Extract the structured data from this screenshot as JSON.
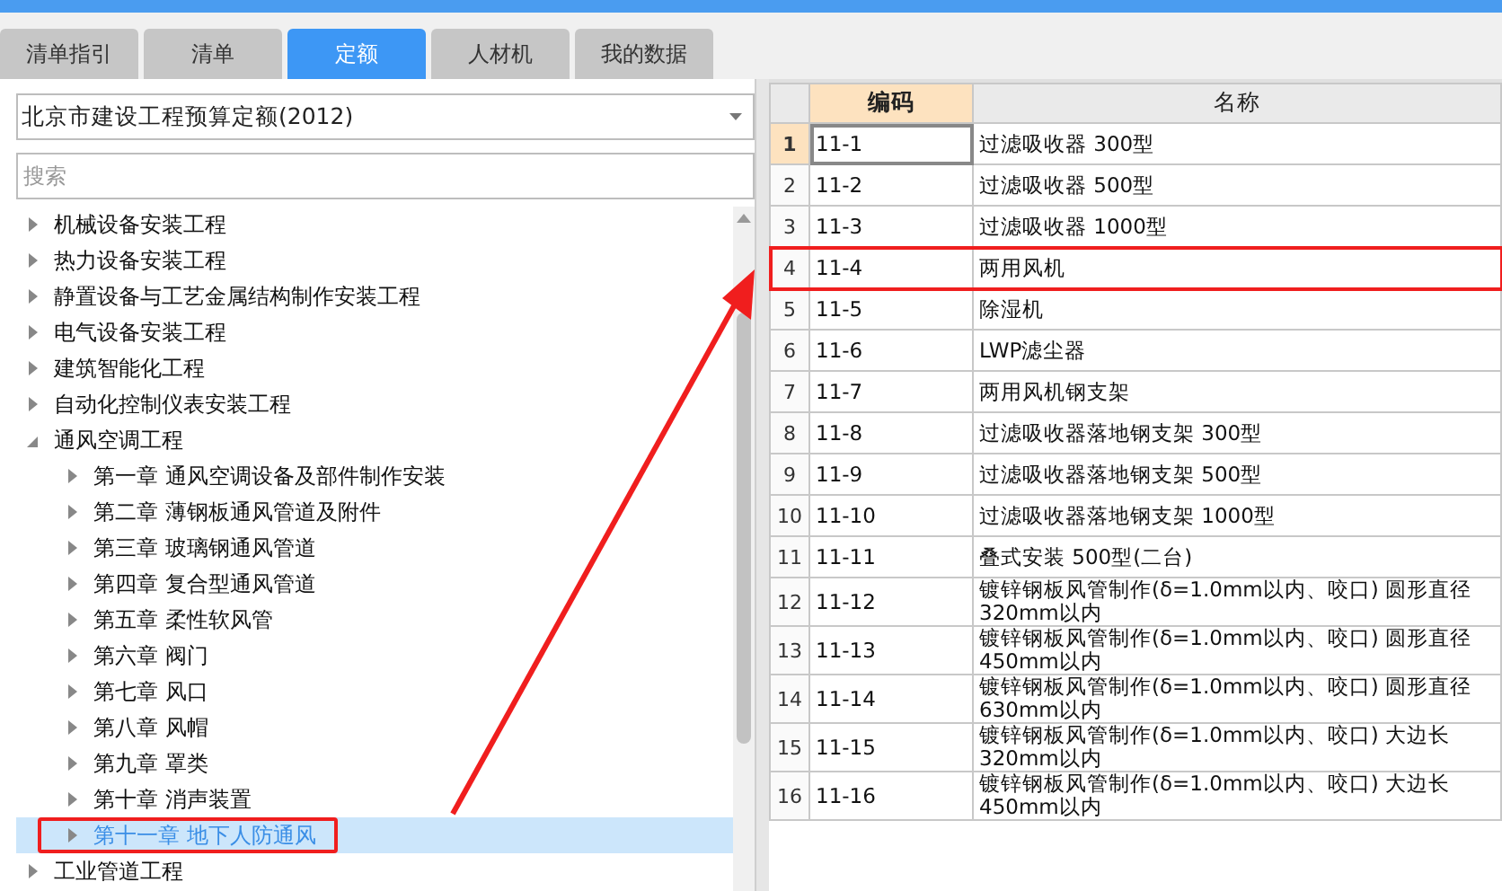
{
  "tabs": [
    {
      "label": "清单指引",
      "selected": false
    },
    {
      "label": "清单",
      "selected": false
    },
    {
      "label": "定额",
      "selected": true
    },
    {
      "label": "人材机",
      "selected": false
    },
    {
      "label": "我的数据",
      "selected": false
    }
  ],
  "library": {
    "value": "北京市建设工程预算定额(2012)"
  },
  "search": {
    "placeholder": "搜索"
  },
  "tree": [
    {
      "label": "机械设备安装工程",
      "expanded": false
    },
    {
      "label": "热力设备安装工程",
      "expanded": false
    },
    {
      "label": "静置设备与工艺金属结构制作安装工程",
      "expanded": false
    },
    {
      "label": "电气设备安装工程",
      "expanded": false
    },
    {
      "label": "建筑智能化工程",
      "expanded": false
    },
    {
      "label": "自动化控制仪表安装工程",
      "expanded": false
    },
    {
      "label": "通风空调工程",
      "expanded": true,
      "children": [
        {
          "label": "第一章 通风空调设备及部件制作安装",
          "selected": false
        },
        {
          "label": "第二章 薄钢板通风管道及附件",
          "selected": false
        },
        {
          "label": "第三章 玻璃钢通风管道",
          "selected": false
        },
        {
          "label": "第四章 复合型通风管道",
          "selected": false
        },
        {
          "label": "第五章 柔性软风管",
          "selected": false
        },
        {
          "label": "第六章 阀门",
          "selected": false
        },
        {
          "label": "第七章 风口",
          "selected": false
        },
        {
          "label": "第八章 风帽",
          "selected": false
        },
        {
          "label": "第九章 罩类",
          "selected": false
        },
        {
          "label": "第十章 消声装置",
          "selected": false
        },
        {
          "label": "第十一章 地下人防通风",
          "selected": true,
          "outlined": true
        }
      ]
    },
    {
      "label": "工业管道工程",
      "expanded": false
    }
  ],
  "table": {
    "columns": [
      "编码",
      "名称"
    ],
    "rows": [
      {
        "num": "1",
        "code": "11-1",
        "name": "过滤吸收器 300型",
        "selected": true,
        "outlined": false
      },
      {
        "num": "2",
        "code": "11-2",
        "name": "过滤吸收器 500型",
        "selected": false,
        "outlined": false
      },
      {
        "num": "3",
        "code": "11-3",
        "name": "过滤吸收器 1000型",
        "selected": false,
        "outlined": false
      },
      {
        "num": "4",
        "code": "11-4",
        "name": "两用风机",
        "selected": false,
        "outlined": true
      },
      {
        "num": "5",
        "code": "11-5",
        "name": "除湿机",
        "selected": false,
        "outlined": false
      },
      {
        "num": "6",
        "code": "11-6",
        "name": "LWP滤尘器",
        "selected": false,
        "outlined": false
      },
      {
        "num": "7",
        "code": "11-7",
        "name": "两用风机钢支架",
        "selected": false,
        "outlined": false
      },
      {
        "num": "8",
        "code": "11-8",
        "name": "过滤吸收器落地钢支架 300型",
        "selected": false,
        "outlined": false
      },
      {
        "num": "9",
        "code": "11-9",
        "name": "过滤吸收器落地钢支架 500型",
        "selected": false,
        "outlined": false
      },
      {
        "num": "10",
        "code": "11-10",
        "name": "过滤吸收器落地钢支架 1000型",
        "selected": false,
        "outlined": false
      },
      {
        "num": "11",
        "code": "11-11",
        "name": "叠式安装 500型(二台)",
        "selected": false,
        "outlined": false
      },
      {
        "num": "12",
        "code": "11-12",
        "name": "镀锌钢板风管制作(δ=1.0mm以内、咬口) 圆形直径320mm以内",
        "selected": false,
        "outlined": false
      },
      {
        "num": "13",
        "code": "11-13",
        "name": "镀锌钢板风管制作(δ=1.0mm以内、咬口) 圆形直径450mm以内",
        "selected": false,
        "outlined": false
      },
      {
        "num": "14",
        "code": "11-14",
        "name": "镀锌钢板风管制作(δ=1.0mm以内、咬口) 圆形直径630mm以内",
        "selected": false,
        "outlined": false
      },
      {
        "num": "15",
        "code": "11-15",
        "name": "镀锌钢板风管制作(δ=1.0mm以内、咬口) 大边长320mm以内",
        "selected": false,
        "outlined": false
      },
      {
        "num": "16",
        "code": "11-16",
        "name": "镀锌钢板风管制作(δ=1.0mm以内、咬口) 大边长450mm以内",
        "selected": false,
        "outlined": false
      }
    ]
  }
}
